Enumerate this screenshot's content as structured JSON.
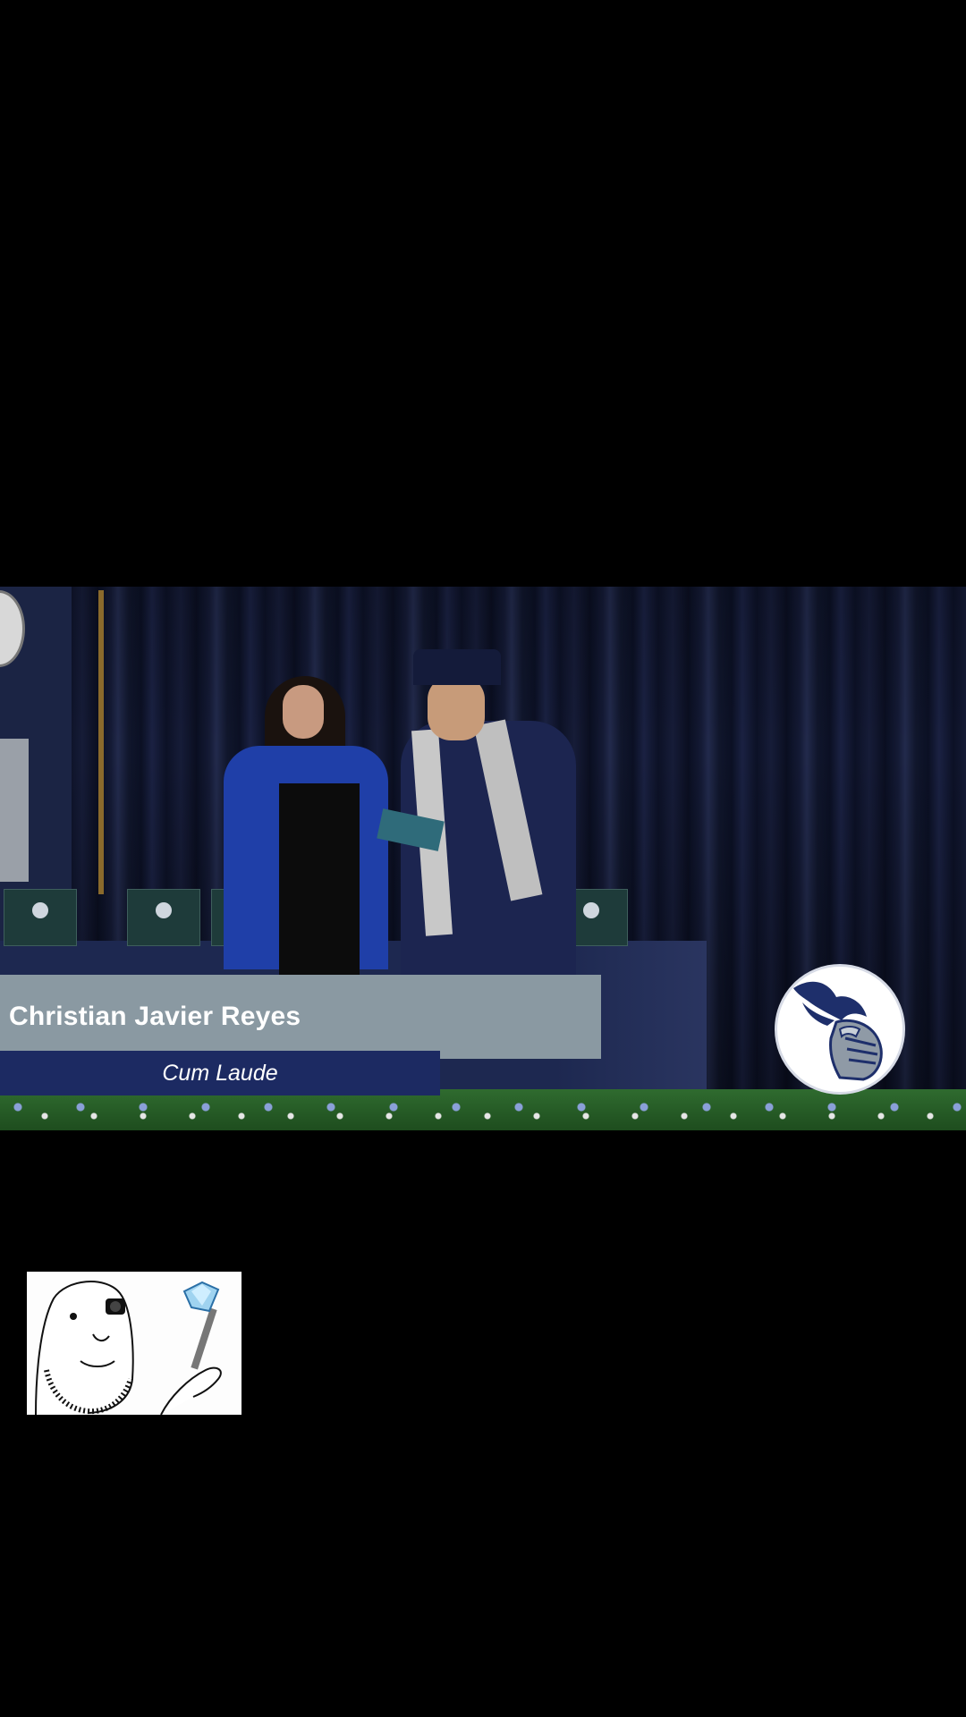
{
  "video": {
    "lower_third": {
      "name": "Christian Javier Reyes",
      "honor": "Cum Laude"
    },
    "logo_icon": "knight-helmet-logo-icon"
  },
  "overlay": {
    "sticker_icon": "wojak-jeweler-inspecting-diamond-sticker-icon"
  }
}
